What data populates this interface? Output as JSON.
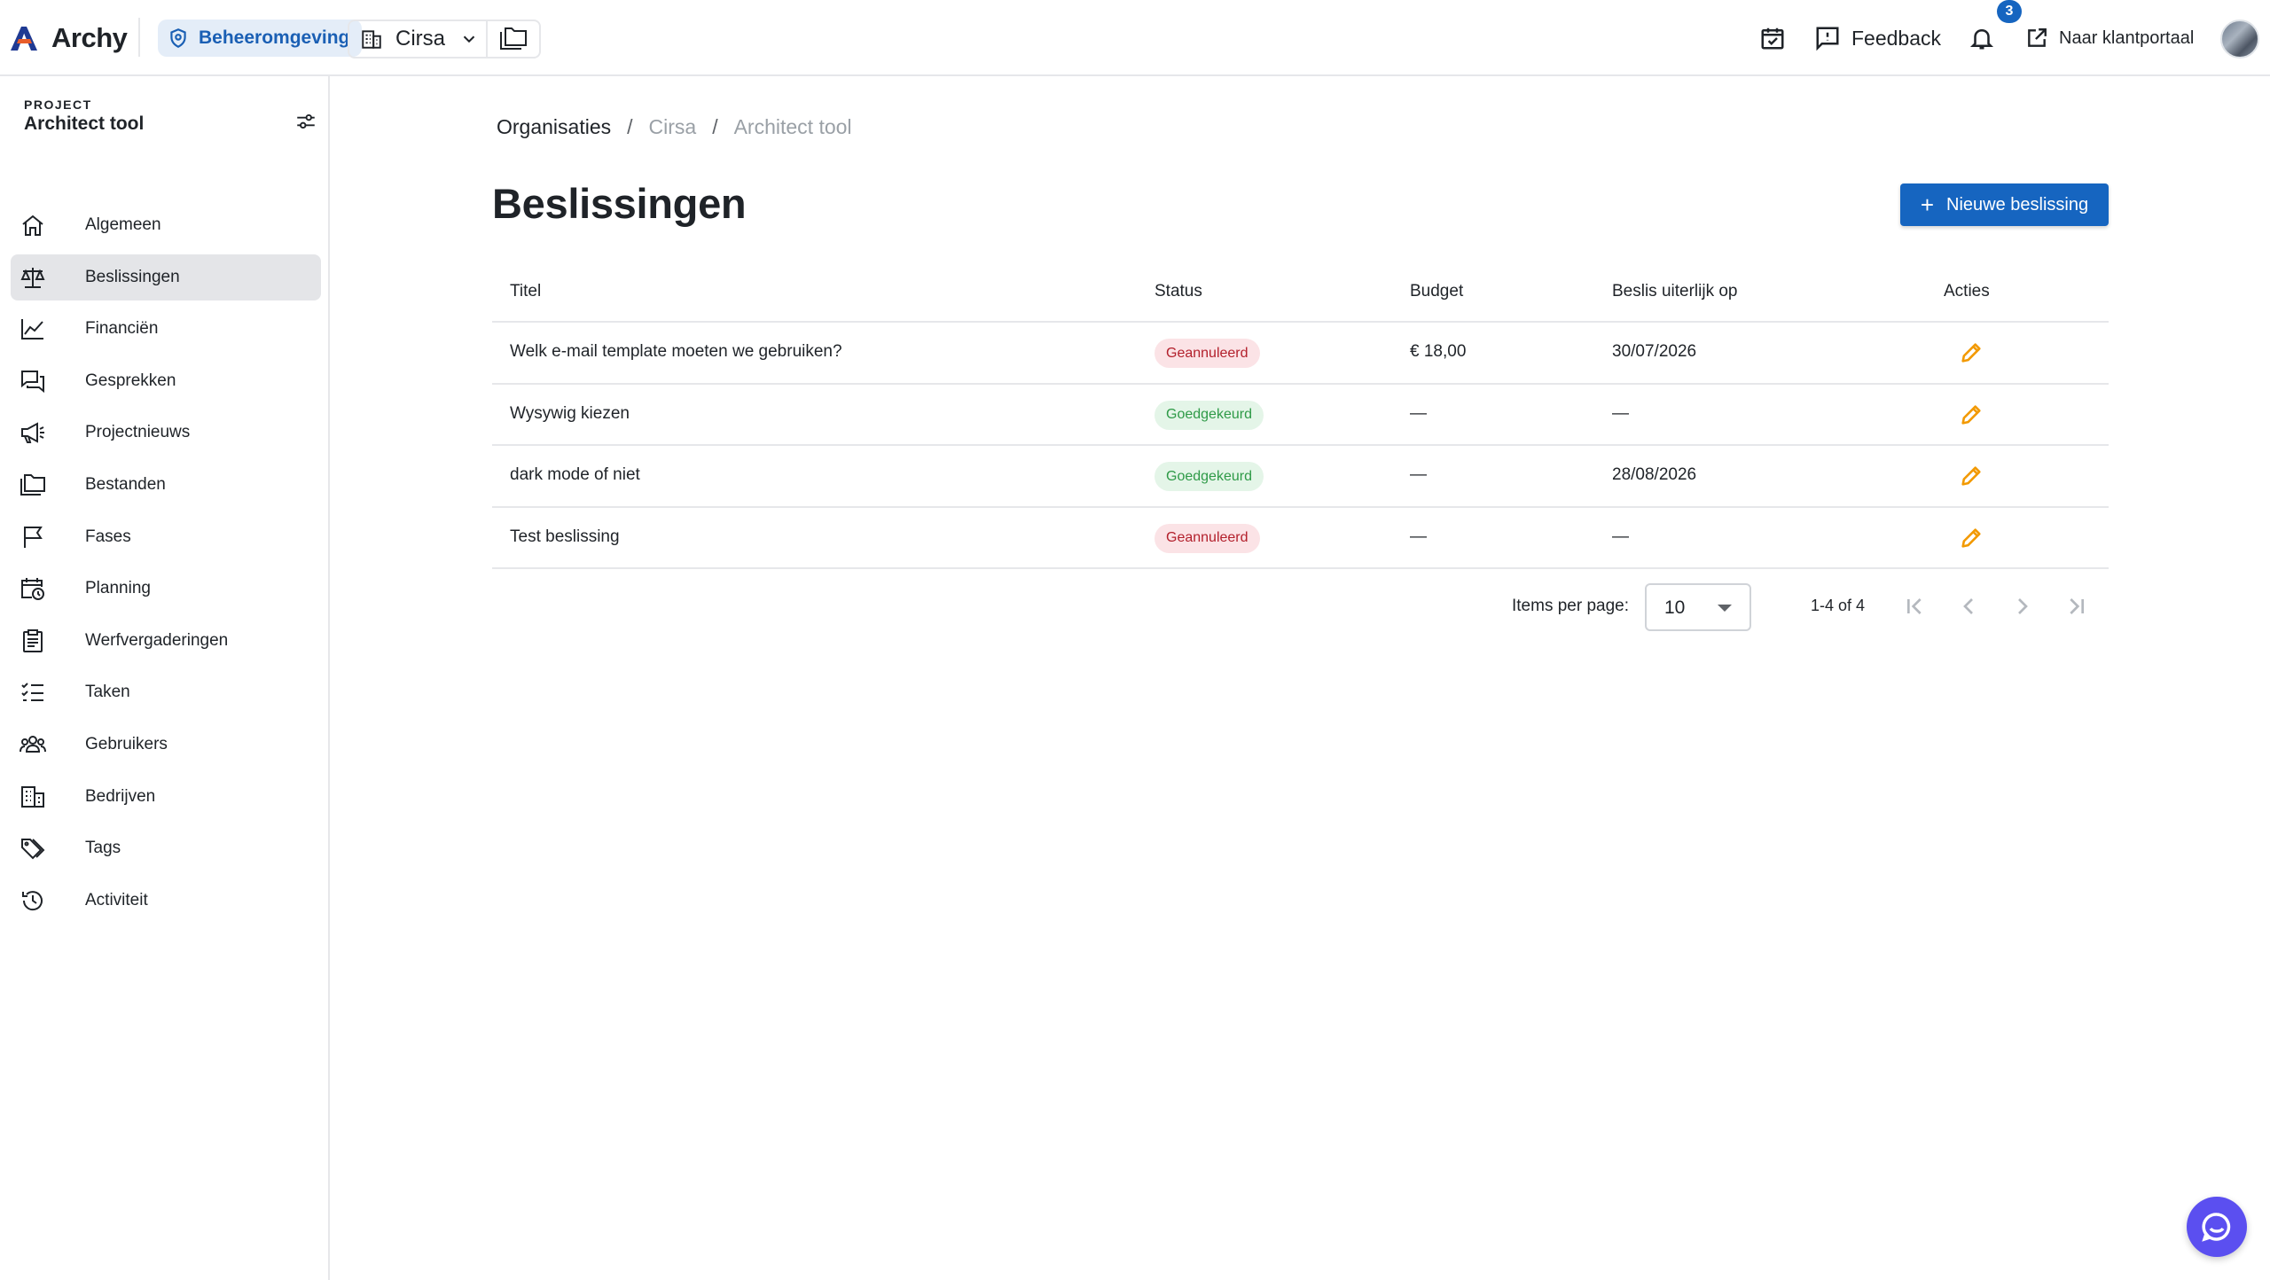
{
  "app": {
    "name": "Archy"
  },
  "topbar": {
    "environment_label": "Beheeromgeving",
    "organization": "Cirsa",
    "feedback_label": "Feedback",
    "notifications_count": "3",
    "client_portal_label": "Naar klantportaal"
  },
  "sidebar": {
    "overline": "PROJECT",
    "project_name": "Architect tool",
    "items": [
      {
        "label": "Algemeen",
        "icon": "home-icon"
      },
      {
        "label": "Beslissingen",
        "icon": "scale-icon",
        "active": true
      },
      {
        "label": "Financiën",
        "icon": "chart-line-icon"
      },
      {
        "label": "Gesprekken",
        "icon": "chat-icon"
      },
      {
        "label": "Projectnieuws",
        "icon": "megaphone-icon"
      },
      {
        "label": "Bestanden",
        "icon": "folders-icon"
      },
      {
        "label": "Fases",
        "icon": "flag-icon"
      },
      {
        "label": "Planning",
        "icon": "calendar-clock-icon"
      },
      {
        "label": "Werfvergaderingen",
        "icon": "clipboard-icon"
      },
      {
        "label": "Taken",
        "icon": "checklist-icon"
      },
      {
        "label": "Gebruikers",
        "icon": "users-icon"
      },
      {
        "label": "Bedrijven",
        "icon": "building-icon"
      },
      {
        "label": "Tags",
        "icon": "tags-icon"
      },
      {
        "label": "Activiteit",
        "icon": "history-icon"
      }
    ]
  },
  "breadcrumb": {
    "items": [
      "Organisaties",
      "Cirsa",
      "Architect tool"
    ],
    "separator": "/"
  },
  "page": {
    "title": "Beslissingen",
    "new_button_label": "Nieuwe beslissing"
  },
  "table": {
    "headers": {
      "title": "Titel",
      "status": "Status",
      "budget": "Budget",
      "deadline": "Beslis uiterlijk op",
      "actions": "Acties"
    },
    "rows": [
      {
        "title": "Welk e-mail template moeten we gebruiken?",
        "status": "Geannuleerd",
        "status_kind": "cancelled",
        "budget": "€ 18,00",
        "deadline": "30/07/2026"
      },
      {
        "title": "Wysywig kiezen",
        "status": "Goedgekeurd",
        "status_kind": "approved",
        "budget": "—",
        "deadline": "—"
      },
      {
        "title": "dark mode of niet",
        "status": "Goedgekeurd",
        "status_kind": "approved",
        "budget": "—",
        "deadline": "28/08/2026"
      },
      {
        "title": "Test beslissing",
        "status": "Geannuleerd",
        "status_kind": "cancelled",
        "budget": "—",
        "deadline": "—"
      }
    ]
  },
  "pagination": {
    "items_per_page_label": "Items per page:",
    "items_per_page": "10",
    "range": "1-4 of 4"
  },
  "colors": {
    "primary": "#1665c0",
    "cancelled_bg": "#fbe3e6",
    "cancelled_text": "#b3202c",
    "approved_bg": "#e4f5e8",
    "approved_text": "#2e9a47",
    "edit_icon": "#f29900",
    "chat_fab": "#5b4ff0"
  }
}
